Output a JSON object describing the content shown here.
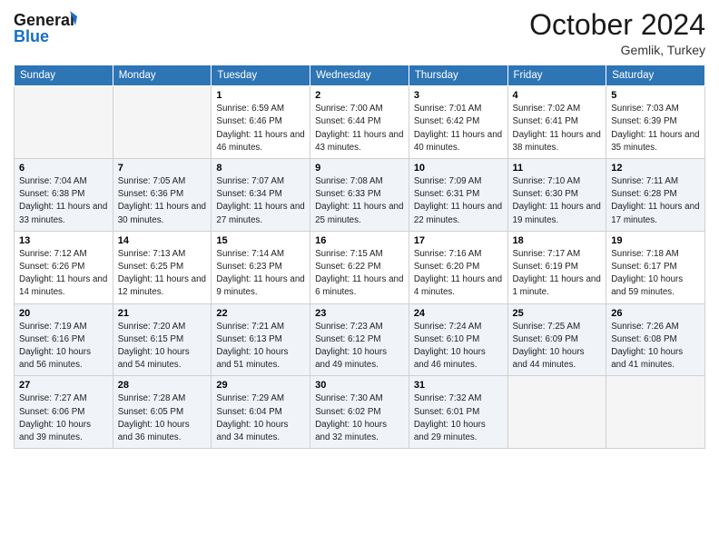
{
  "header": {
    "logo_line1": "General",
    "logo_line2": "Blue",
    "month": "October 2024",
    "location": "Gemlik, Turkey"
  },
  "weekdays": [
    "Sunday",
    "Monday",
    "Tuesday",
    "Wednesday",
    "Thursday",
    "Friday",
    "Saturday"
  ],
  "rows": [
    [
      {
        "day": "",
        "info": ""
      },
      {
        "day": "",
        "info": ""
      },
      {
        "day": "1",
        "info": "Sunrise: 6:59 AM\nSunset: 6:46 PM\nDaylight: 11 hours and 46 minutes."
      },
      {
        "day": "2",
        "info": "Sunrise: 7:00 AM\nSunset: 6:44 PM\nDaylight: 11 hours and 43 minutes."
      },
      {
        "day": "3",
        "info": "Sunrise: 7:01 AM\nSunset: 6:42 PM\nDaylight: 11 hours and 40 minutes."
      },
      {
        "day": "4",
        "info": "Sunrise: 7:02 AM\nSunset: 6:41 PM\nDaylight: 11 hours and 38 minutes."
      },
      {
        "day": "5",
        "info": "Sunrise: 7:03 AM\nSunset: 6:39 PM\nDaylight: 11 hours and 35 minutes."
      }
    ],
    [
      {
        "day": "6",
        "info": "Sunrise: 7:04 AM\nSunset: 6:38 PM\nDaylight: 11 hours and 33 minutes."
      },
      {
        "day": "7",
        "info": "Sunrise: 7:05 AM\nSunset: 6:36 PM\nDaylight: 11 hours and 30 minutes."
      },
      {
        "day": "8",
        "info": "Sunrise: 7:07 AM\nSunset: 6:34 PM\nDaylight: 11 hours and 27 minutes."
      },
      {
        "day": "9",
        "info": "Sunrise: 7:08 AM\nSunset: 6:33 PM\nDaylight: 11 hours and 25 minutes."
      },
      {
        "day": "10",
        "info": "Sunrise: 7:09 AM\nSunset: 6:31 PM\nDaylight: 11 hours and 22 minutes."
      },
      {
        "day": "11",
        "info": "Sunrise: 7:10 AM\nSunset: 6:30 PM\nDaylight: 11 hours and 19 minutes."
      },
      {
        "day": "12",
        "info": "Sunrise: 7:11 AM\nSunset: 6:28 PM\nDaylight: 11 hours and 17 minutes."
      }
    ],
    [
      {
        "day": "13",
        "info": "Sunrise: 7:12 AM\nSunset: 6:26 PM\nDaylight: 11 hours and 14 minutes."
      },
      {
        "day": "14",
        "info": "Sunrise: 7:13 AM\nSunset: 6:25 PM\nDaylight: 11 hours and 12 minutes."
      },
      {
        "day": "15",
        "info": "Sunrise: 7:14 AM\nSunset: 6:23 PM\nDaylight: 11 hours and 9 minutes."
      },
      {
        "day": "16",
        "info": "Sunrise: 7:15 AM\nSunset: 6:22 PM\nDaylight: 11 hours and 6 minutes."
      },
      {
        "day": "17",
        "info": "Sunrise: 7:16 AM\nSunset: 6:20 PM\nDaylight: 11 hours and 4 minutes."
      },
      {
        "day": "18",
        "info": "Sunrise: 7:17 AM\nSunset: 6:19 PM\nDaylight: 11 hours and 1 minute."
      },
      {
        "day": "19",
        "info": "Sunrise: 7:18 AM\nSunset: 6:17 PM\nDaylight: 10 hours and 59 minutes."
      }
    ],
    [
      {
        "day": "20",
        "info": "Sunrise: 7:19 AM\nSunset: 6:16 PM\nDaylight: 10 hours and 56 minutes."
      },
      {
        "day": "21",
        "info": "Sunrise: 7:20 AM\nSunset: 6:15 PM\nDaylight: 10 hours and 54 minutes."
      },
      {
        "day": "22",
        "info": "Sunrise: 7:21 AM\nSunset: 6:13 PM\nDaylight: 10 hours and 51 minutes."
      },
      {
        "day": "23",
        "info": "Sunrise: 7:23 AM\nSunset: 6:12 PM\nDaylight: 10 hours and 49 minutes."
      },
      {
        "day": "24",
        "info": "Sunrise: 7:24 AM\nSunset: 6:10 PM\nDaylight: 10 hours and 46 minutes."
      },
      {
        "day": "25",
        "info": "Sunrise: 7:25 AM\nSunset: 6:09 PM\nDaylight: 10 hours and 44 minutes."
      },
      {
        "day": "26",
        "info": "Sunrise: 7:26 AM\nSunset: 6:08 PM\nDaylight: 10 hours and 41 minutes."
      }
    ],
    [
      {
        "day": "27",
        "info": "Sunrise: 7:27 AM\nSunset: 6:06 PM\nDaylight: 10 hours and 39 minutes."
      },
      {
        "day": "28",
        "info": "Sunrise: 7:28 AM\nSunset: 6:05 PM\nDaylight: 10 hours and 36 minutes."
      },
      {
        "day": "29",
        "info": "Sunrise: 7:29 AM\nSunset: 6:04 PM\nDaylight: 10 hours and 34 minutes."
      },
      {
        "day": "30",
        "info": "Sunrise: 7:30 AM\nSunset: 6:02 PM\nDaylight: 10 hours and 32 minutes."
      },
      {
        "day": "31",
        "info": "Sunrise: 7:32 AM\nSunset: 6:01 PM\nDaylight: 10 hours and 29 minutes."
      },
      {
        "day": "",
        "info": ""
      },
      {
        "day": "",
        "info": ""
      }
    ]
  ]
}
